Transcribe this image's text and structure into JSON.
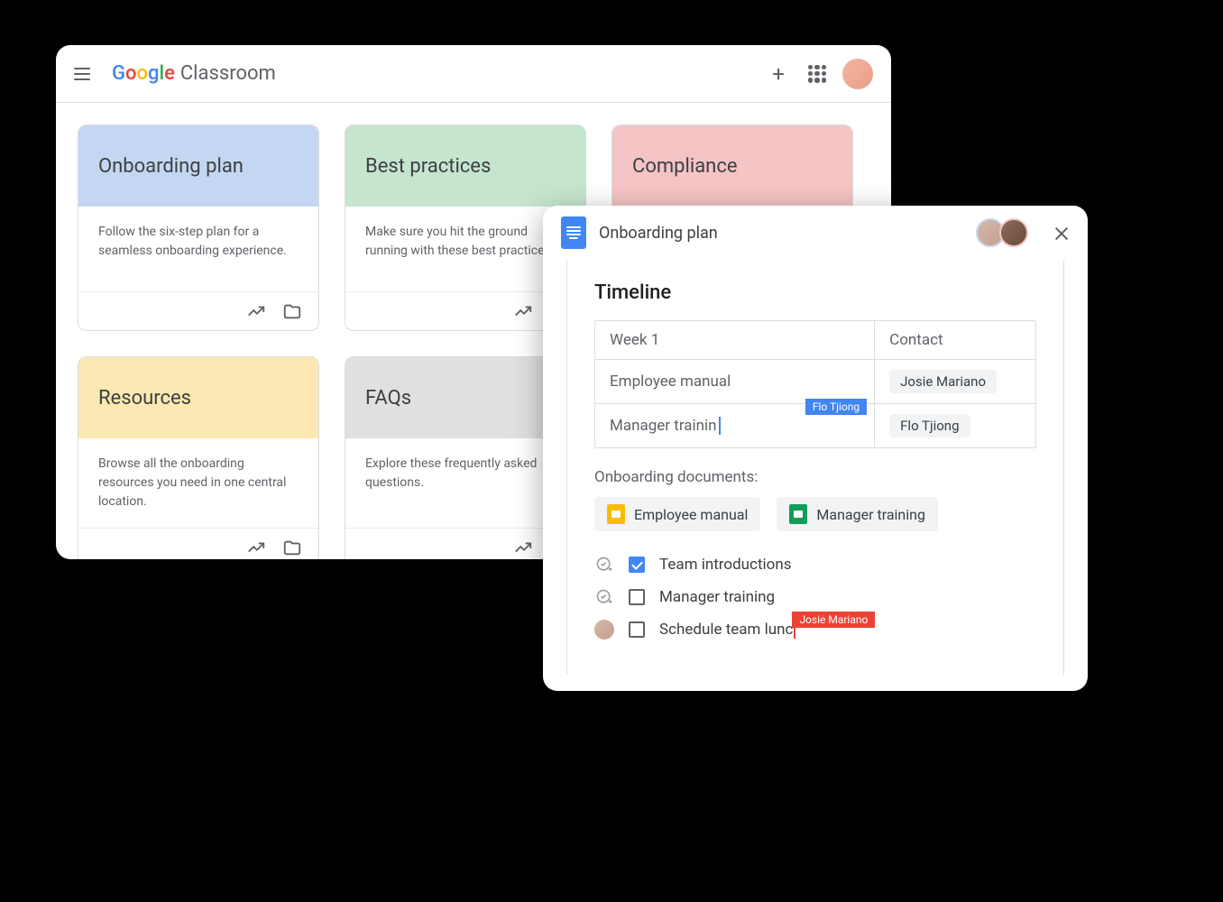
{
  "classroom": {
    "app_name": "Classroom",
    "logo_letters": [
      "G",
      "o",
      "o",
      "g",
      "l",
      "e"
    ],
    "cards": [
      {
        "title": "Onboarding plan",
        "desc": "Follow the six-step plan for a seamless onboarding experience.",
        "color": "blue"
      },
      {
        "title": "Best practices",
        "desc": "Make sure you hit the ground running with these best practices.",
        "color": "green"
      },
      {
        "title": "Compliance",
        "desc": "",
        "color": "red"
      },
      {
        "title": "Resources",
        "desc": "Browse all the onboarding resources you need in one central location.",
        "color": "yellow"
      },
      {
        "title": "FAQs",
        "desc": "Explore these frequently asked questions.",
        "color": "gray"
      }
    ]
  },
  "docs": {
    "title": "Onboarding plan",
    "timeline_heading": "Timeline",
    "table": {
      "header": {
        "left": "Week 1",
        "right": "Contact"
      },
      "rows": [
        {
          "left": "Employee manual",
          "right_chip": "Josie Mariano"
        },
        {
          "left": "Manager trainin",
          "right_chip": "Flo Tjiong",
          "editing_tag": "Flo Tjiong"
        }
      ]
    },
    "documents_label": "Onboarding documents:",
    "doc_chips": [
      {
        "label": "Employee manual",
        "app": "slides"
      },
      {
        "label": "Manager training",
        "app": "sheets"
      }
    ],
    "checklist": [
      {
        "label": "Team introductions",
        "checked": true,
        "prefix": "add-task"
      },
      {
        "label": "Manager training",
        "checked": false,
        "prefix": "add-task"
      },
      {
        "label": "Schedule team lunc",
        "checked": false,
        "prefix": "avatar",
        "editing_tag": "Josie Mariano"
      }
    ]
  }
}
